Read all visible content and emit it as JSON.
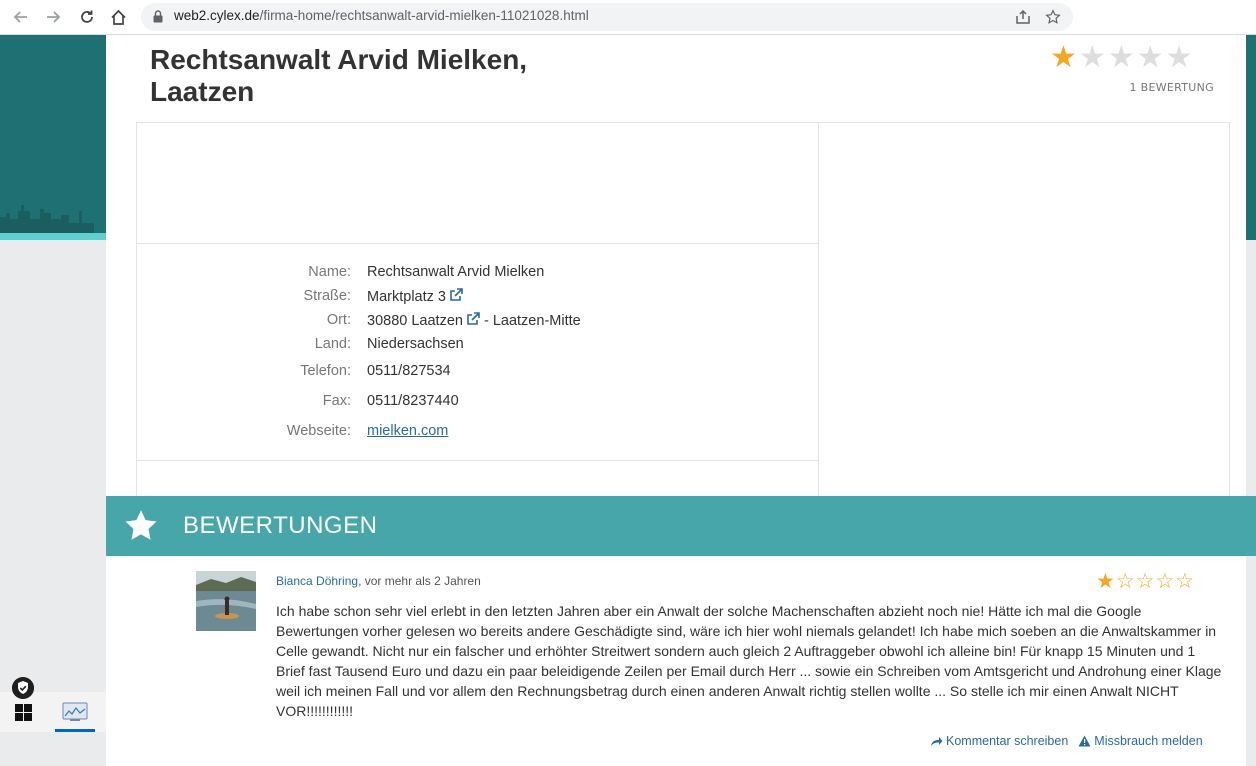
{
  "browser": {
    "url_host": "web2.cylex.de",
    "url_path": "/firma-home/rechtsanwalt-arvid-mielken-11021028.html",
    "back_icon": "arrow-left-icon",
    "forward_icon": "arrow-right-icon",
    "reload_icon": "reload-icon",
    "home_icon": "home-icon",
    "share_icon": "share-icon",
    "bookmark_icon": "star-outline-icon"
  },
  "business": {
    "title": "Rechtsanwalt Arvid Mielken, Laatzen",
    "rating_stars": 1,
    "rating_max": 5,
    "rating_count_label": "1 BEWERTUNG"
  },
  "info": {
    "rows": [
      {
        "label": "Name:",
        "value": "Rechtsanwalt Arvid Mielken"
      },
      {
        "label": "Straße:",
        "value": "Marktplatz 3"
      },
      {
        "label": "Ort:",
        "value": "30880 Laatzen",
        "suffix": " - Laatzen-Mitte"
      },
      {
        "label": "Land:",
        "value": "Niedersachsen"
      },
      {
        "label": "Telefon:",
        "value": "0511/827534"
      },
      {
        "label": "Fax:",
        "value": "0511/8237440"
      },
      {
        "label": "Webseite:",
        "value": "mielken.com"
      }
    ]
  },
  "reviews": {
    "header": "BEWERTUNGEN",
    "items": [
      {
        "author": "Bianca Döhring",
        "when": ", vor mehr als 2 Jahren",
        "stars": 1,
        "text": "Ich habe schon sehr viel erlebt in den letzten Jahren aber ein Anwalt der solche Machenschaften abzieht noch nie! Hätte ich mal die Google Bewertungen vorher gelesen wo bereits andere Geschädigte sind, wäre ich hier wohl niemals gelandet! Ich habe mich soeben an die Anwaltskammer in Celle gewandt. Nicht nur ein falscher und erhöhter Streitwert sondern auch gleich 2 Auftraggeber obwohl ich alleine bin! Für knapp 15 Minuten und 1 Brief fast Tausend Euro und dazu ein paar beleidigende Zeilen per Email durch Herr ... sowie ein Schreiben vom Amtsgericht und Androhung einer Klage weil ich meinen Fall und vor allem den Rechnungsbetrag durch einen anderen Anwalt richtig stellen wollte ... So stelle ich mir einen Anwalt NICHT VOR!!!!!!!!!!!!",
        "comment_label": "Kommentar schreiben",
        "report_label": "Missbrauch melden"
      }
    ]
  },
  "colors": {
    "teal_dark": "#1f7072",
    "teal_bar": "#47a6aa",
    "star_gold": "#f5a623",
    "star_grey": "#dddddd",
    "link": "#2a6aa3"
  }
}
